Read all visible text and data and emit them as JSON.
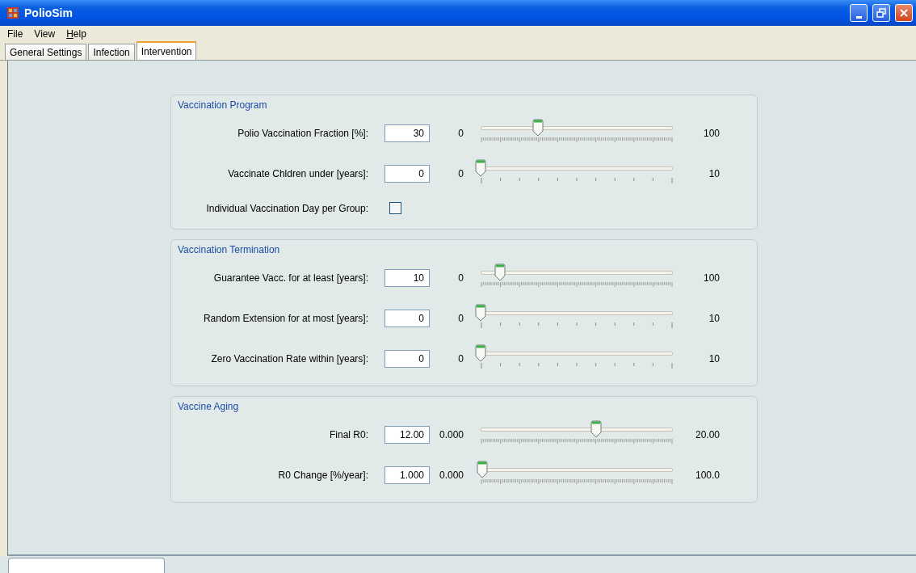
{
  "window": {
    "title": "PolioSim"
  },
  "menu": [
    {
      "label": "File",
      "underline_first": false
    },
    {
      "label": "View",
      "underline_first": false
    },
    {
      "label": "Help",
      "underline_first": true
    }
  ],
  "tabs": [
    {
      "label": "General Settings",
      "selected": false
    },
    {
      "label": "Infection",
      "selected": false
    },
    {
      "label": "Intervention",
      "selected": true
    }
  ],
  "groups": [
    {
      "title": "Vaccination Program",
      "rows": [
        {
          "kind": "fine-slider",
          "label": "Polio Vaccination Fraction [%]:",
          "value": "30",
          "min": "0",
          "max": "100",
          "level": 0.3
        },
        {
          "kind": "coarse-slider",
          "label": "Vaccinate Chldren under [years]:",
          "value": "0",
          "min": "0",
          "max": "10",
          "level": 0
        },
        {
          "kind": "checkbox",
          "label": "Individual Vaccination Day per Group:",
          "checked": false
        }
      ]
    },
    {
      "title": "Vaccination Termination",
      "rows": [
        {
          "kind": "fine-slider",
          "label": "Guarantee Vacc. for at least [years]:",
          "value": "10",
          "min": "0",
          "max": "100",
          "level": 0.1
        },
        {
          "kind": "coarse-slider",
          "label": "Random Extension for at most [years]:",
          "value": "0",
          "min": "0",
          "max": "10",
          "level": 0
        },
        {
          "kind": "coarse-slider",
          "label": "Zero Vaccination Rate within [years]:",
          "value": "0",
          "min": "0",
          "max": "10",
          "level": 0
        }
      ]
    },
    {
      "title": "Vaccine Aging",
      "rows": [
        {
          "kind": "fine-slider",
          "label": "Final R0:",
          "value": "12.00",
          "min": "0.000",
          "max": "20.00",
          "level": 0.6
        },
        {
          "kind": "fine-slider",
          "label": "R0 Change [%/year]:",
          "value": "1.000",
          "min": "0.000",
          "max": "100.0",
          "level": 0.01
        }
      ]
    }
  ]
}
